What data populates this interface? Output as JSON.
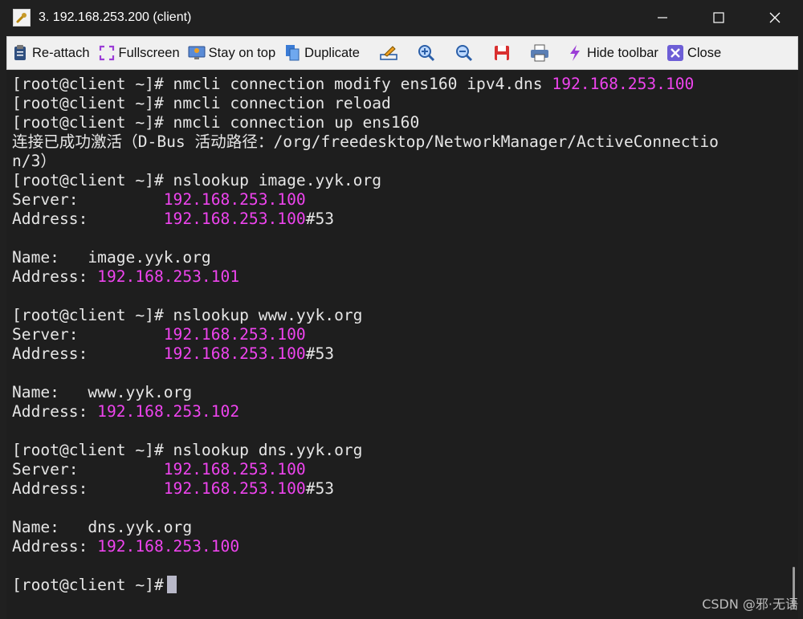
{
  "window": {
    "title": "3. 192.168.253.200 (client)"
  },
  "toolbar": {
    "reattach": "Re-attach",
    "fullscreen": "Fullscreen",
    "stay_on_top": "Stay on top",
    "duplicate": "Duplicate",
    "hide_toolbar": "Hide toolbar",
    "close": "Close"
  },
  "colors": {
    "ip_highlight": "#ee44ee",
    "terminal_bg": "#1e1e1e",
    "terminal_fg": "#e6e6e6"
  },
  "terminal": {
    "l1_cmd": "[root@client ~]# nmcli connection modify ens160 ipv4.dns ",
    "l1_ip": "192.168.253.100",
    "l2": "[root@client ~]# nmcli connection reload",
    "l3": "[root@client ~]# nmcli connection up ens160",
    "l4": "连接已成功激活（D-Bus 活动路径：/org/freedesktop/NetworkManager/ActiveConnectio",
    "l5": "n/3）",
    "q1": {
      "cmd": "[root@client ~]# nslookup image.yyk.org",
      "server_label": "Server:         ",
      "server_ip": "192.168.253.100",
      "address_label": "Address:        ",
      "address_ip": "192.168.253.100",
      "address_port": "#53",
      "name_label": "Name:   ",
      "name_value": "image.yyk.org",
      "result_label": "Address: ",
      "result_ip": "192.168.253.101"
    },
    "q2": {
      "cmd": "[root@client ~]# nslookup www.yyk.org",
      "server_label": "Server:         ",
      "server_ip": "192.168.253.100",
      "address_label": "Address:        ",
      "address_ip": "192.168.253.100",
      "address_port": "#53",
      "name_label": "Name:   ",
      "name_value": "www.yyk.org",
      "result_label": "Address: ",
      "result_ip": "192.168.253.102"
    },
    "q3": {
      "cmd": "[root@client ~]# nslookup dns.yyk.org",
      "server_label": "Server:         ",
      "server_ip": "192.168.253.100",
      "address_label": "Address:        ",
      "address_ip": "192.168.253.100",
      "address_port": "#53",
      "name_label": "Name:   ",
      "name_value": "dns.yyk.org",
      "result_label": "Address: ",
      "result_ip": "192.168.253.100"
    },
    "prompt": "[root@client ~]#"
  },
  "watermark": "CSDN @邪·无语"
}
